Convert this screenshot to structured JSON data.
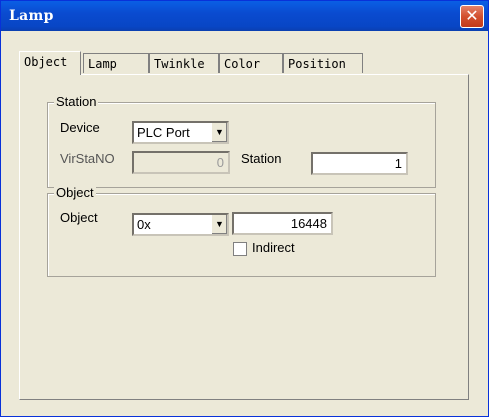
{
  "window": {
    "title": "Lamp"
  },
  "tabs": [
    {
      "label": "Object"
    },
    {
      "label": "Lamp"
    },
    {
      "label": "Twinkle"
    },
    {
      "label": "Color"
    },
    {
      "label": "Position"
    }
  ],
  "station_group": {
    "legend": "Station",
    "device_label": "Device",
    "device_value": "PLC Port",
    "virstano_label": "VirStaNO",
    "virstano_value": "0",
    "station_label": "Station",
    "station_value": "1"
  },
  "object_group": {
    "legend": "Object",
    "object_label": "Object",
    "object_type_value": "0x",
    "object_address_value": "16448",
    "indirect_label": "Indirect",
    "indirect_checked": false
  }
}
